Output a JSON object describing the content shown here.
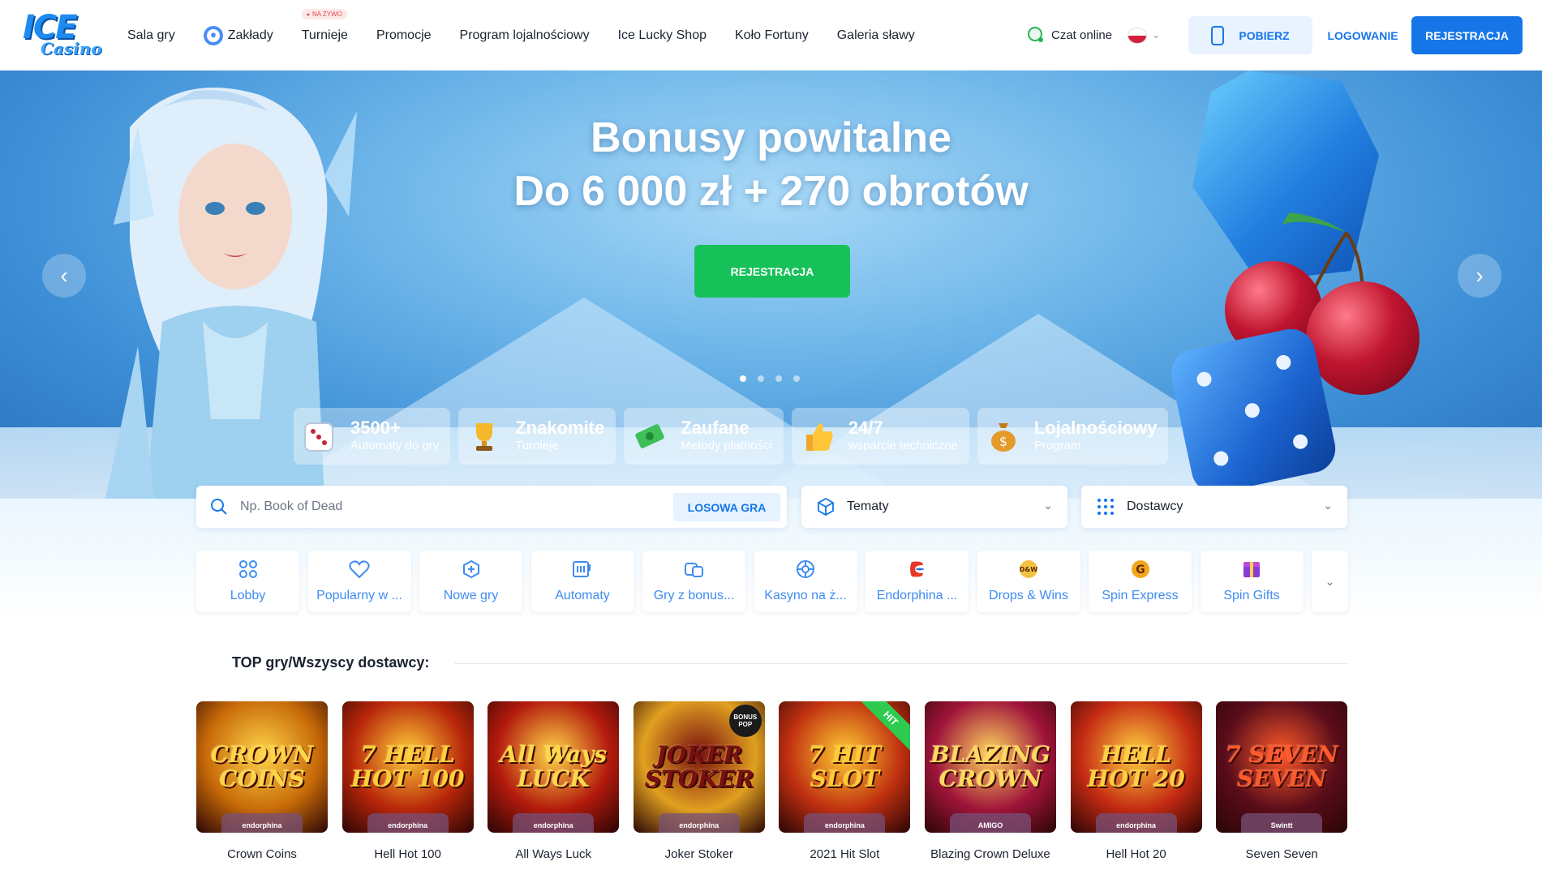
{
  "brand": {
    "logo_line1": "ICE",
    "logo_line2": "Casino"
  },
  "nav": {
    "items": [
      {
        "label": "Sala gry"
      },
      {
        "label": "Zakłady"
      },
      {
        "label": "Turnieje",
        "badge": "NA ŻYWO"
      },
      {
        "label": "Promocje"
      },
      {
        "label": "Program lojalnościowy"
      },
      {
        "label": "Ice Lucky Shop"
      },
      {
        "label": "Koło Fortuny"
      },
      {
        "label": "Galeria sławy"
      }
    ],
    "chat_label": "Czat online",
    "download_label": "POBIERZ",
    "login_label": "LOGOWANIE",
    "register_label": "REJESTRACJA"
  },
  "hero": {
    "title_line1": "Bonusy powitalne",
    "title_line2": "Do 6 000 zł + 270 obrotów",
    "cta_label": "REJESTRACJA",
    "slides_count": 4,
    "active_slide": 1
  },
  "features": [
    {
      "title": "3500+",
      "subtitle": "Automaty do gry",
      "icon": "dice-icon"
    },
    {
      "title": "Znakomite",
      "subtitle": "Turnieje",
      "icon": "trophy-icon"
    },
    {
      "title": "Zaufane",
      "subtitle": "Metody płatności",
      "icon": "money-icon"
    },
    {
      "title": "24/7",
      "subtitle": "wsparcie techniczne",
      "icon": "thumbs-up-icon"
    },
    {
      "title": "Lojalnościowy",
      "subtitle": "Program",
      "icon": "money-bag-icon"
    }
  ],
  "search": {
    "placeholder": "Np. Book of Dead",
    "random_label": "LOSOWA GRA"
  },
  "filters": {
    "topics_label": "Tematy",
    "providers_label": "Dostawcy"
  },
  "categories": [
    {
      "label": "Lobby",
      "icon": "grid-icon"
    },
    {
      "label": "Popularny w ...",
      "icon": "heart-icon"
    },
    {
      "label": "Nowe gry",
      "icon": "plus-badge-icon"
    },
    {
      "label": "Automaty",
      "icon": "slot-machine-icon"
    },
    {
      "label": "Gry z bonus...",
      "icon": "bonus-icon"
    },
    {
      "label": "Kasyno na ż...",
      "icon": "roulette-icon"
    },
    {
      "label": "Endorphina ...",
      "icon": "endorphina-icon"
    },
    {
      "label": "Drops & Wins",
      "icon": "drops-wins-icon"
    },
    {
      "label": "Spin Express",
      "icon": "spin-express-icon"
    },
    {
      "label": "Spin Gifts",
      "icon": "spin-gifts-icon"
    }
  ],
  "section": {
    "title": "TOP gry/Wszyscy dostawcy:"
  },
  "games": [
    {
      "name": "Crown Coins",
      "art": "CROWN COINS",
      "provider": "endorphina",
      "bg": "#c76a08",
      "fg": "#ffd54a"
    },
    {
      "name": "Hell Hot 100",
      "art": "7 HELL HOT 100",
      "provider": "endorphina",
      "bg": "#b8260a",
      "fg": "#ffcf3a"
    },
    {
      "name": "All Ways Luck",
      "art": "All Ways LUCK",
      "provider": "endorphina",
      "bg": "#b31a0c",
      "fg": "#ffd84a"
    },
    {
      "name": "Joker Stoker",
      "art": "JOKER STOKER",
      "provider": "endorphina",
      "bg": "#e0a020",
      "fg": "#7a1010",
      "badge": "BONUS POP"
    },
    {
      "name": "2021 Hit Slot",
      "art": "7 HIT SLOT",
      "provider": "endorphina",
      "bg": "#c03010",
      "fg": "#ffcc33",
      "ribbon": "HIT"
    },
    {
      "name": "Blazing Crown Deluxe",
      "art": "BLAZING CROWN",
      "provider": "AMIGO",
      "bg": "#a0143a",
      "fg": "#ffd860"
    },
    {
      "name": "Hell Hot 20",
      "art": "HELL HOT 20",
      "provider": "endorphina",
      "bg": "#c42a12",
      "fg": "#ffd040"
    },
    {
      "name": "Seven Seven",
      "art": "7 SEVEN SEVEN",
      "provider": "Swintt",
      "bg": "#5a0d1a",
      "fg": "#ff5a2a"
    }
  ]
}
